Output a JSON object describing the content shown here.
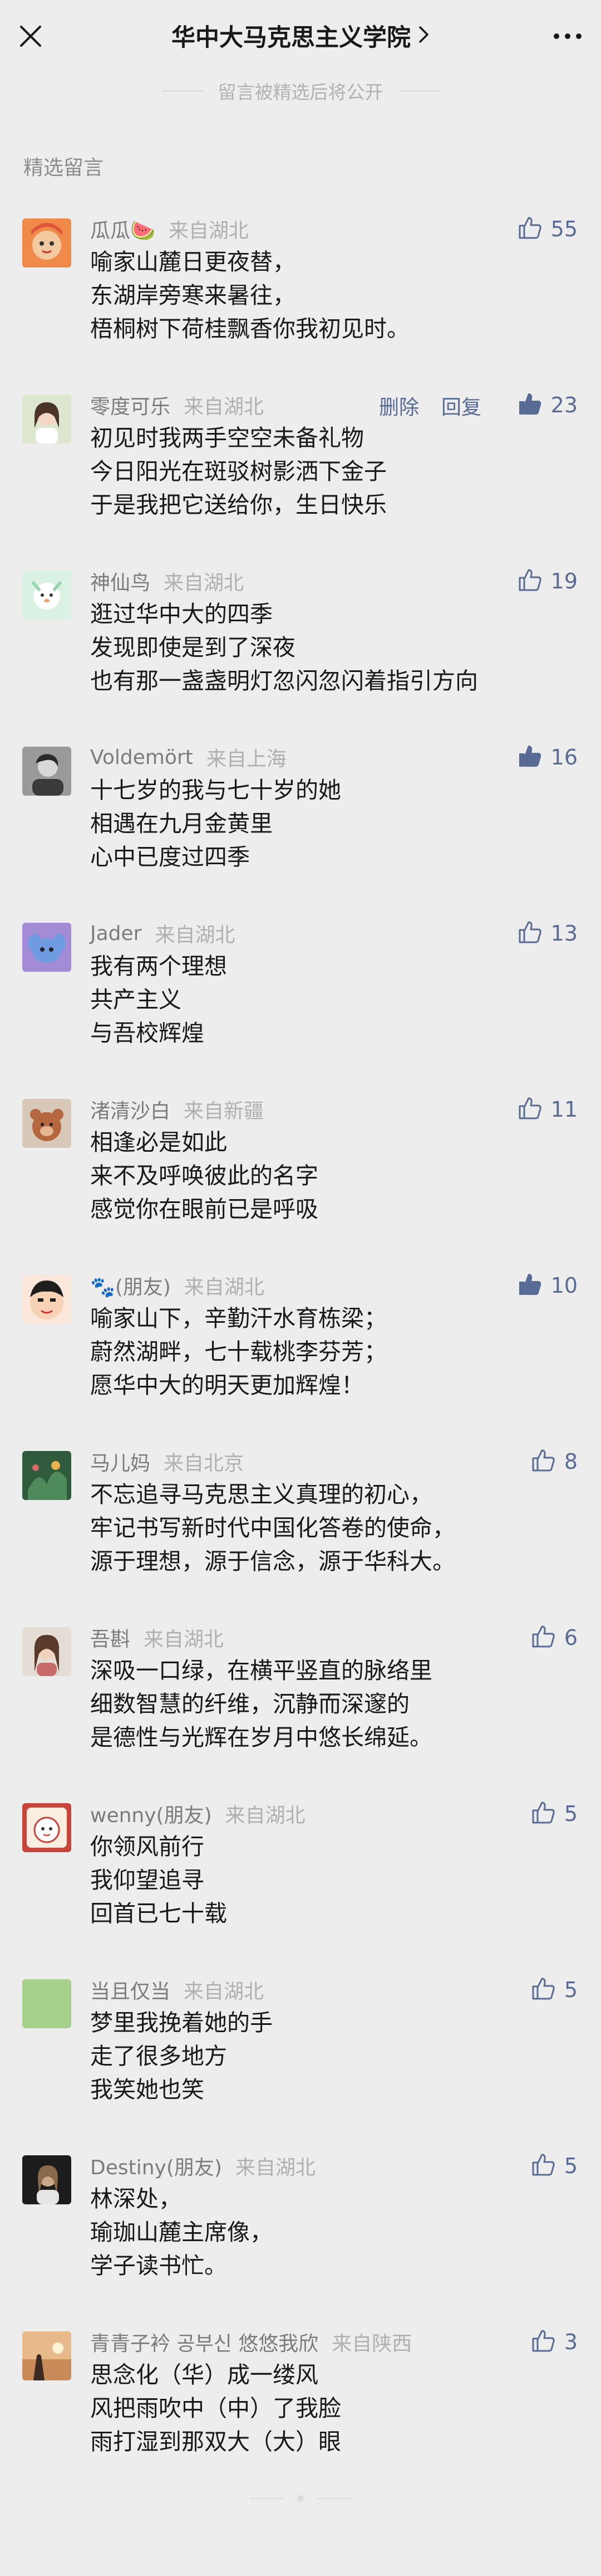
{
  "header": {
    "title": "华中大马克思主义学院",
    "notice": "留言被精选后将公开"
  },
  "section_label": "精选留言",
  "colors": {
    "like_blue": "#576b95",
    "background": "#ededed"
  },
  "comments": [
    {
      "nickname": "瓜瓜🍉",
      "location": "来自湖北",
      "likes": "55",
      "liked": false,
      "text": "喻家山麓日更夜替，\n东湖岸旁寒来暑往，\n梧桐树下荷桂飘香你我初见时。"
    },
    {
      "nickname": "零度可乐",
      "location": "来自湖北",
      "likes": "23",
      "liked": true,
      "delete_label": "删除",
      "reply_label": "回复",
      "text": "初见时我两手空空未备礼物\n今日阳光在斑驳树影洒下金子\n于是我把它送给你，生日快乐"
    },
    {
      "nickname": "神仙鸟",
      "location": "来自湖北",
      "likes": "19",
      "liked": false,
      "text": "逛过华中大的四季\n发现即使是到了深夜\n也有那一盏盏明灯忽闪忽闪着指引方向"
    },
    {
      "nickname": "Voldemört",
      "location": "来自上海",
      "likes": "16",
      "liked": true,
      "text": "十七岁的我与七十岁的她\n相遇在九月金黄里\n心中已度过四季"
    },
    {
      "nickname": "Jader",
      "location": "来自湖北",
      "likes": "13",
      "liked": false,
      "text": "我有两个理想\n共产主义\n与吾校辉煌"
    },
    {
      "nickname": "渚清沙白",
      "location": "来自新疆",
      "likes": "11",
      "liked": false,
      "text": "相逢必是如此\n来不及呼唤彼此的名字\n感觉你在眼前已是呼吸"
    },
    {
      "nickname": "🐾(朋友)",
      "location": "来自湖北",
      "likes": "10",
      "liked": true,
      "text": "喻家山下，辛勤汗水育栋梁；\n蔚然湖畔，七十载桃李芬芳；\n愿华中大的明天更加辉煌！"
    },
    {
      "nickname": "马儿妈",
      "location": "来自北京",
      "likes": "8",
      "liked": false,
      "text": "不忘追寻马克思主义真理的初心，\n牢记书写新时代中国化答卷的使命，\n源于理想，源于信念，源于华科大。"
    },
    {
      "nickname": "吾斟",
      "location": "来自湖北",
      "likes": "6",
      "liked": false,
      "text": "深吸一口绿，在横平竖直的脉络里\n细数智慧的纤维，沉静而深邃的\n是德性与光辉在岁月中悠长绵延。"
    },
    {
      "nickname": "wenny(朋友)",
      "location": "来自湖北",
      "likes": "5",
      "liked": false,
      "text": "你领风前行\n我仰望追寻\n回首已七十载"
    },
    {
      "nickname": "当且仅当",
      "location": "来自湖北",
      "likes": "5",
      "liked": false,
      "text": "梦里我挽着她的手\n走了很多地方\n我笑她也笑"
    },
    {
      "nickname": "Destiny(朋友)",
      "location": "来自湖北",
      "likes": "5",
      "liked": false,
      "text": "林深处，\n瑜珈山麓主席像，\n学子读书忙。"
    },
    {
      "nickname": "青青子衿 공부신 悠悠我欣",
      "location": "来自陕西",
      "likes": "3",
      "liked": false,
      "text": "思念化（华）成一缕风\n风把雨吹中（中）了我脸\n雨打湿到那双大（大）眼"
    }
  ]
}
